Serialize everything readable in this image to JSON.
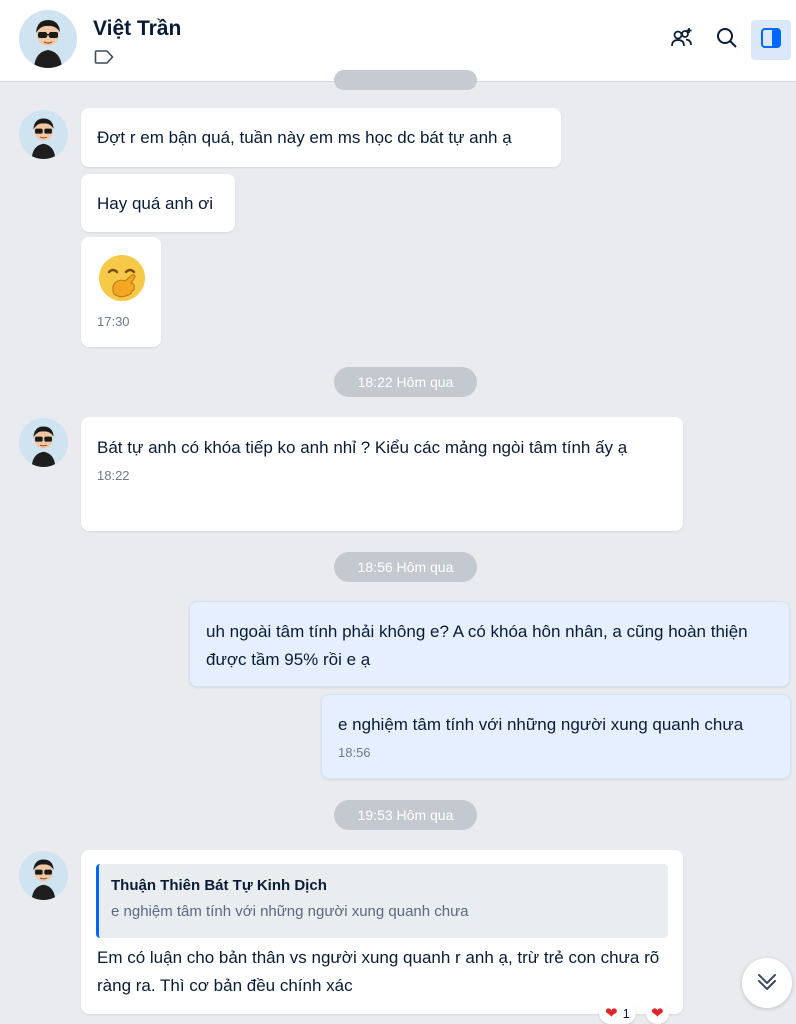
{
  "header": {
    "contact_name": "Việt Trần",
    "tag_icon": "tag-icon",
    "add_member_icon": "add-user-icon",
    "search_icon": "search-icon",
    "panel_icon": "sidebar-toggle-icon"
  },
  "messages": [
    {
      "text": "Đợt r em bận quá, tuần này em ms học dc bát tự anh ạ"
    },
    {
      "text": "Hay quá anh ơi"
    },
    {
      "emoji": "hand-over-mouth-emoji",
      "time": "17:30"
    },
    {
      "text": "Bát tự anh có khóa tiếp ko anh nhỉ ? Kiểu các mảng ngòi tâm tính ấy ạ",
      "time": "18:22"
    },
    {
      "text": "uh ngoài tâm tính phải không e? A có khóa hôn nhân, a cũng hoàn thiện được tầm 95% rồi e ạ"
    },
    {
      "text": "e nghiệm tâm tính với những người xung quanh chưa",
      "time": "18:56"
    },
    {
      "quote_title": "Thuận Thiên Bát Tự Kinh Dịch",
      "quote_text": "e nghiệm tâm tính với những người xung quanh chưa",
      "text": "Em có luận cho bản thân vs người xung quanh r anh ạ, trừ trẻ con chưa rõ ràng ra. Thì cơ bản đều chính xác"
    }
  ],
  "separators": [
    "18:22 Hôm qua",
    "18:56 Hôm qua",
    "19:53 Hôm qua"
  ],
  "reactions": {
    "count": "1",
    "icon": "heart-icon"
  },
  "colors": {
    "accent": "#0068ff",
    "outgoing_bubble": "#e5efff",
    "heart": "#e0252b"
  }
}
